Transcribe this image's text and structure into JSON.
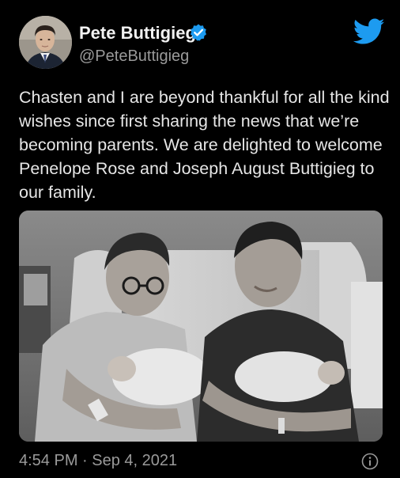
{
  "author": {
    "display_name": "Pete Buttigieg",
    "handle": "@PeteButtigieg",
    "verified": true,
    "avatar_icon": "profile-photo"
  },
  "tweet": {
    "text": "Chasten and I are beyond thankful for all the kind\nwishes since first sharing the news that we’re\nbecoming parents. We are delighted to welcome\nPenelope Rose and Joseph August Buttigieg to\nour family.",
    "timestamp": "4:54 PM · Sep 4, 2021",
    "media_icon": "photo-two-men-holding-newborns"
  },
  "icons": {
    "brand": "twitter-bird-icon",
    "verified": "verified-badge-icon",
    "info": "info-icon"
  },
  "colors": {
    "background": "#000000",
    "brand": "#1d9bf0",
    "text_primary": "#e6e6e6",
    "text_secondary": "#9a9a9a"
  }
}
